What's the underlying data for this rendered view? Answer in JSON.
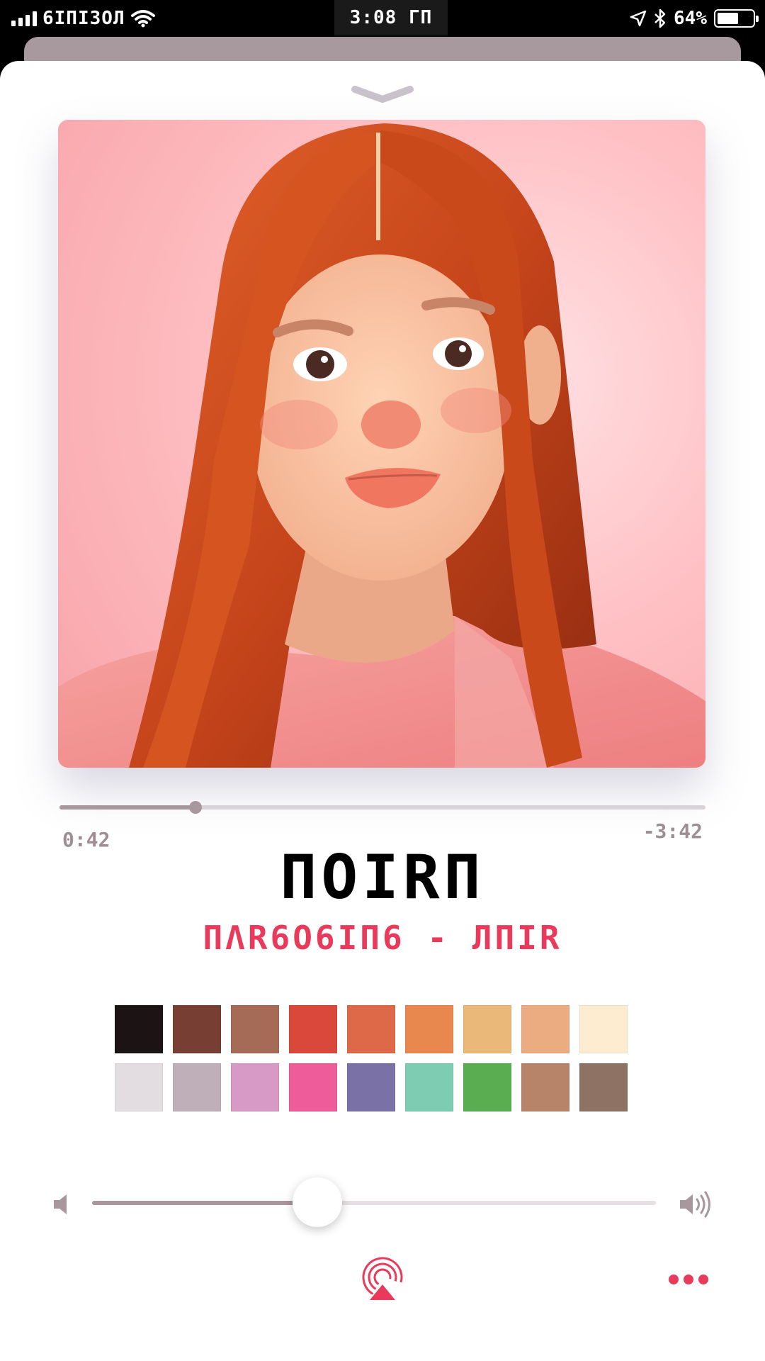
{
  "status_bar": {
    "carrier": "6IПI3ОЛ",
    "time": "3:08 ΓП",
    "battery_percent": "64%",
    "battery_level": 0.64,
    "icons": [
      "signal-bars-icon",
      "wifi-icon",
      "location-arrow-icon",
      "bluetooth-icon",
      "battery-icon"
    ]
  },
  "player": {
    "artwork_description_icon": "album-artwork",
    "progress_fraction": 0.21,
    "elapsed": "0:42",
    "remaining": "-3:42",
    "title": "ΠOIRΠ",
    "subtitle": "ΠΛR6O6IΠ6 - ЛПIR",
    "volume_fraction": 0.4
  },
  "swatches": [
    [
      "#1c1414",
      "#773e33",
      "#a56b57",
      "#d9483b",
      "#dd6949",
      "#e8874e",
      "#eab879",
      "#eaac80",
      "#feecd0"
    ],
    [
      "#e3dde2",
      "#bfafb8",
      "#d79ac6",
      "#ee5d9a",
      "#7a71a6",
      "#7ecdb2",
      "#5bad52",
      "#b7846a",
      "#8e7365"
    ]
  ],
  "colors": {
    "accent": "#ea3a5b",
    "track": "#a8979d",
    "sheet": "#ffffff"
  }
}
